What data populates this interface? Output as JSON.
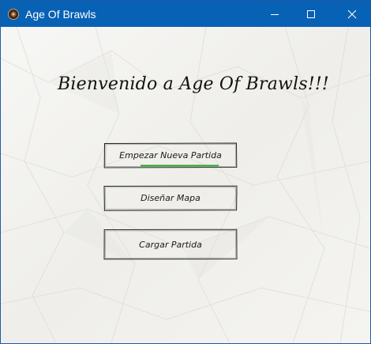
{
  "window": {
    "title": "Age Of Brawls",
    "controls": [
      "minimize-icon",
      "maximize-icon",
      "close-icon"
    ],
    "titlebar_color": "#0761b5"
  },
  "main": {
    "heading": "Bienvenido a Age Of Brawls!!!",
    "buttons": {
      "new_game": "Empezar Nueva Partida",
      "design_map": "Diseñar Mapa",
      "load_game": "Cargar Partida"
    },
    "focus_accent_color": "#2aa52a"
  }
}
